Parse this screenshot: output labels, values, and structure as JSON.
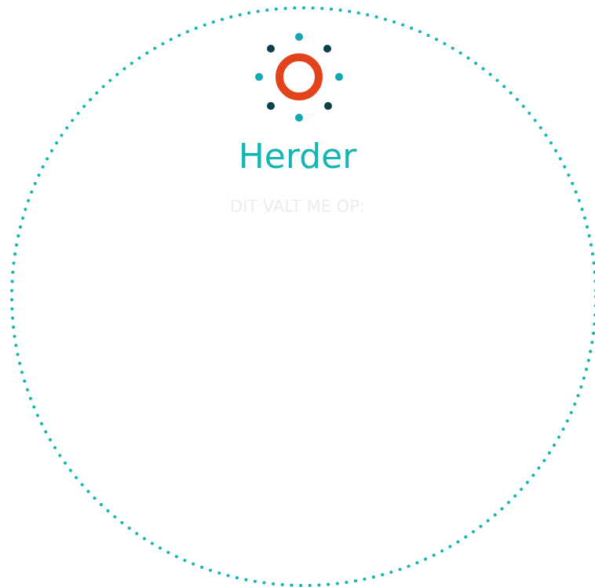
{
  "title": "Herder",
  "subtitle": "DIT VALT ME OP:",
  "colors": {
    "ring_dots": "#14b5b3",
    "title": "#14b5b3",
    "subtitle": "#ececec",
    "logo_ring": "#e2431a",
    "logo_dot_light": "#14a8b5",
    "logo_dot_dark": "#0e3f4c"
  },
  "icons": {
    "logo": "sun-ring-icon"
  }
}
